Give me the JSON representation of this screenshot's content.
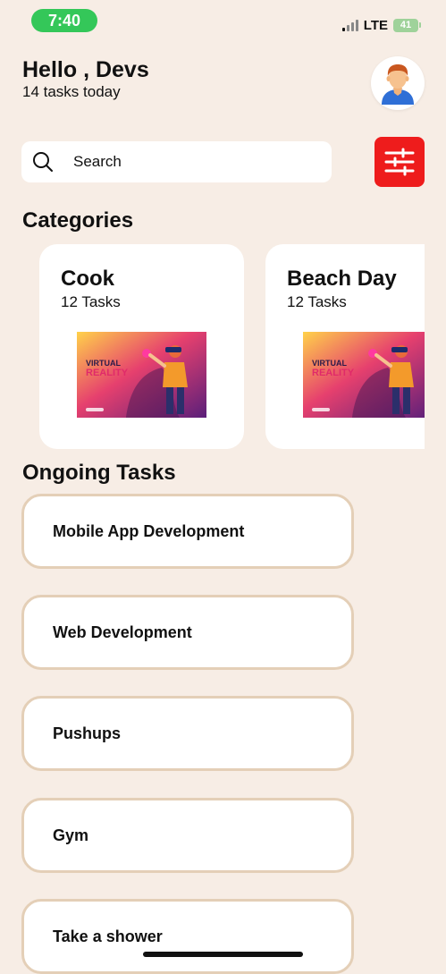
{
  "status_bar": {
    "time": "7:40",
    "network": "LTE",
    "battery": "41"
  },
  "header": {
    "greeting": "Hello , Devs",
    "subtitle": "14 tasks today",
    "avatar_icon": "user-avatar-icon"
  },
  "search": {
    "placeholder": "Search",
    "filter_icon": "sliders-icon",
    "filter_color": "#ee1c1c"
  },
  "categories": {
    "title": "Categories",
    "items": [
      {
        "name": "Cook",
        "count": "12 Tasks",
        "image_text": [
          "VIRTUAL",
          "REALITY"
        ]
      },
      {
        "name": "Beach Day",
        "count": "12 Tasks",
        "image_text": [
          "VIRTUAL",
          "REALITY"
        ]
      }
    ]
  },
  "ongoing": {
    "title": "Ongoing Tasks",
    "tasks": [
      {
        "label": "Mobile App Development"
      },
      {
        "label": "Web Development"
      },
      {
        "label": "Pushups"
      },
      {
        "label": "Gym"
      },
      {
        "label": "Take a shower"
      }
    ]
  },
  "colors": {
    "background": "#f7ede5",
    "card_border": "#e4cfb7",
    "time_pill": "#34c759"
  }
}
